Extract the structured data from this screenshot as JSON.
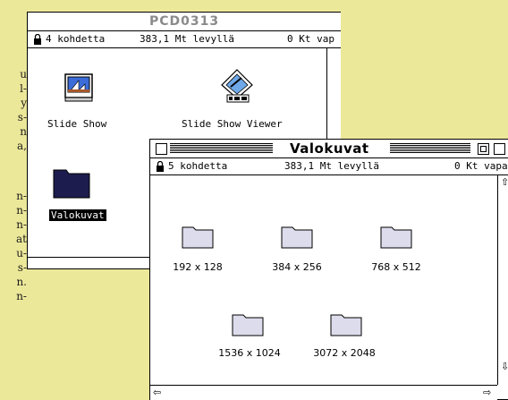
{
  "background_text": [
    "u",
    "l-",
    "y",
    "s-",
    "n",
    "a,",
    "",
    "n-",
    "n-",
    "n-",
    "at",
    "u-",
    "s-",
    "n.",
    "n-"
  ],
  "window_back": {
    "title": "PCD0313",
    "info": {
      "items": "4 kohdetta",
      "disk": "383,1 Mt levyllä",
      "free": "0 Kt vap"
    },
    "icons": [
      {
        "label": "Slide Show",
        "icon": "slide-show-app-icon"
      },
      {
        "label": "Slide Show Viewer",
        "icon": "slide-show-viewer-icon"
      },
      {
        "label": "Valokuvat",
        "icon": "folder-icon",
        "selected": true
      }
    ]
  },
  "window_front": {
    "title": "Valokuvat",
    "info": {
      "items": "5 kohdetta",
      "disk": "383,1 Mt levyllä",
      "free": "0 Kt vapa"
    },
    "folders": [
      {
        "label": "192 x 128"
      },
      {
        "label": "384 x 256"
      },
      {
        "label": "768 x 512"
      },
      {
        "label": "1536 x 1024"
      },
      {
        "label": "3072 x 2048"
      }
    ]
  }
}
